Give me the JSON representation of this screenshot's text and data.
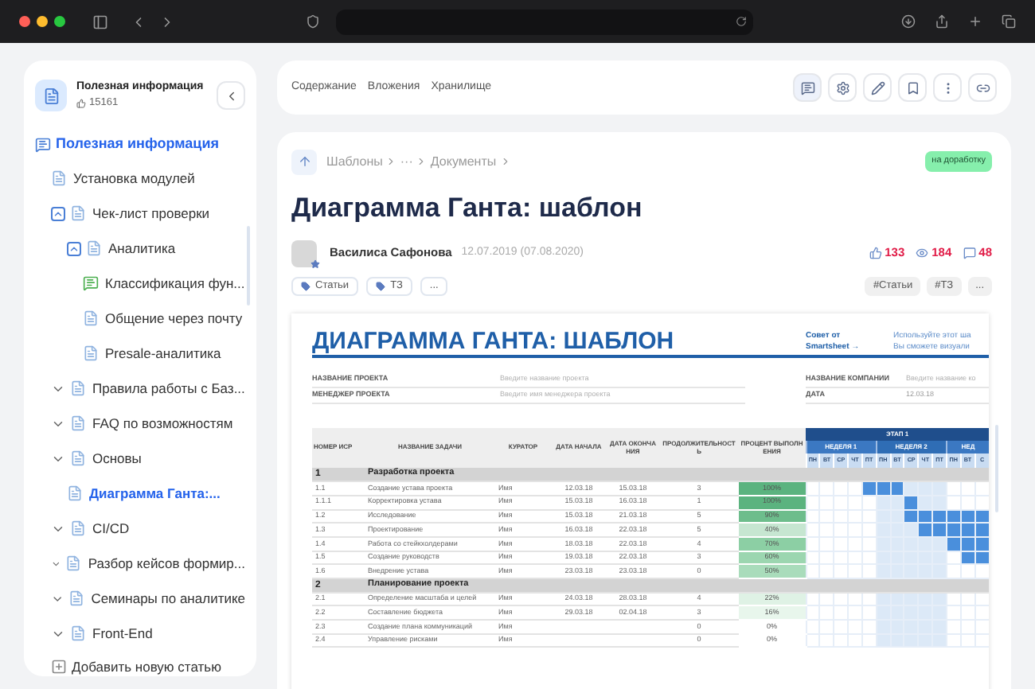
{
  "sidebar": {
    "header": {
      "title": "Полезная информация",
      "likes": "15161"
    },
    "root": {
      "label": "Полезная информация",
      "selected": false,
      "children": [
        {
          "label": "Установка модулей",
          "kind": "page",
          "selected": false
        },
        {
          "label": "Чек-лист проверки",
          "kind": "page",
          "selected": false,
          "expanded": true,
          "children": [
            {
              "label": "Аналитика",
              "kind": "page",
              "selected": false,
              "expanded": true,
              "children": [
                {
                  "label": "Классификация фун...",
                  "kind": "chat",
                  "selected": false
                },
                {
                  "label": "Общение через почту",
                  "kind": "page",
                  "selected": false
                },
                {
                  "label": "Presale-аналитика",
                  "kind": "page",
                  "selected": false
                }
              ]
            }
          ]
        },
        {
          "label": "Правила работы с Баз...",
          "kind": "page",
          "selected": false,
          "expanded": false
        },
        {
          "label": "FAQ по возможностям",
          "kind": "page",
          "selected": false,
          "expanded": false
        },
        {
          "label": "Основы",
          "kind": "page",
          "selected": false,
          "expanded": false,
          "children": [
            {
              "label": "Диаграмма Ганта:...",
              "kind": "page",
              "selected": true
            }
          ]
        },
        {
          "label": "CI/CD",
          "kind": "page",
          "selected": false,
          "expanded": false
        },
        {
          "label": "Разбор кейсов формир...",
          "kind": "page",
          "selected": false,
          "expanded": false
        },
        {
          "label": "Семинары по аналитике",
          "kind": "page",
          "selected": false,
          "expanded": false
        },
        {
          "label": "Front-End",
          "kind": "page",
          "selected": false,
          "expanded": false
        }
      ]
    },
    "add_button": "Добавить новую статью"
  },
  "toolbar": {
    "links": [
      "Содержание",
      "Вложения",
      "Хранилище"
    ]
  },
  "article": {
    "breadcrumbs": [
      "Шаблоны",
      "···",
      "Документы"
    ],
    "status": "на доработку",
    "title": "Диаграмма Ганта: шаблон",
    "author": "Василиса Сафонова",
    "date": "12.07.2019 (07.08.2020)",
    "stats": {
      "likes": "133",
      "views": "184",
      "comments": "48"
    },
    "tags": [
      "Статьи",
      "ТЗ",
      "..."
    ],
    "hashtags": [
      "#Статьи",
      "#ТЗ",
      "..."
    ]
  },
  "document": {
    "title": "ДИАГРАММА ГАНТА: ШАБЛОН",
    "tip_title": [
      "Совет от",
      "Smartsheet →"
    ],
    "tip_text": [
      "Используйте этот ша",
      "Вы сможете визуали"
    ],
    "fields_left": [
      {
        "label": "НАЗВАНИЕ ПРОЕКТА",
        "placeholder": "Введите название проекта"
      },
      {
        "label": "МЕНЕДЖЕР ПРОЕКТА",
        "placeholder": "Введите имя менеджера проекта"
      }
    ],
    "fields_right": [
      {
        "label": "НАЗВАНИЕ КОМПАНИИ",
        "placeholder": "Введите название ко"
      },
      {
        "label": "ДАТА",
        "value": "12.03.18"
      }
    ],
    "gantt": {
      "columns": [
        "НОМЕР ИСР",
        "НАЗВАНИЕ ЗАДАЧИ",
        "КУРАТОР",
        "ДАТА НАЧАЛА",
        "ДАТА ОКОНЧАНИЯ",
        "ПРОДОЛЖИТЕЛЬНОСТЬ",
        "ПРОЦЕНТ ВЫПОЛНЕНИЯ"
      ],
      "stage": "ЭТАП 1",
      "weeks": [
        {
          "label": "НЕДЕЛЯ 1",
          "current": false
        },
        {
          "label": "НЕДЕЛЯ 2",
          "current": true
        },
        {
          "label": "НЕД",
          "current": false
        }
      ],
      "days": [
        "ПН",
        "ВТ",
        "СР",
        "ЧТ",
        "ПТ",
        "ПН",
        "ВТ",
        "СР",
        "ЧТ",
        "ПТ",
        "ПН",
        "ВТ",
        "С"
      ],
      "rows": [
        {
          "kind": "section",
          "wbs": "1",
          "task": "Разработка проекта"
        },
        {
          "kind": "task",
          "wbs": "1.1",
          "task": "Создание устава проекта",
          "curator": "Имя",
          "start": "12.03.18",
          "end": "15.03.18",
          "duration": "3",
          "percent": "100%",
          "color": "#5bb37f",
          "days": [
            false,
            false,
            false,
            false,
            true,
            true,
            true,
            false,
            false,
            false,
            false,
            false,
            false
          ]
        },
        {
          "kind": "task",
          "wbs": "1.1.1",
          "task": "Корректировка устава",
          "curator": "Имя",
          "start": "15.03.18",
          "end": "16.03.18",
          "duration": "1",
          "percent": "100%",
          "color": "#5bb37f",
          "days": [
            false,
            false,
            false,
            false,
            false,
            false,
            false,
            true,
            false,
            false,
            false,
            false,
            false
          ]
        },
        {
          "kind": "task",
          "wbs": "1.2",
          "task": "Исследование",
          "curator": "Имя",
          "start": "15.03.18",
          "end": "21.03.18",
          "duration": "5",
          "percent": "90%",
          "color": "#6dbd8c",
          "days": [
            false,
            false,
            false,
            false,
            false,
            false,
            false,
            true,
            true,
            true,
            true,
            true,
            true
          ]
        },
        {
          "kind": "task",
          "wbs": "1.3",
          "task": "Проектирование",
          "curator": "Имя",
          "start": "16.03.18",
          "end": "22.03.18",
          "duration": "5",
          "percent": "40%",
          "color": "#c6e6d1",
          "days": [
            false,
            false,
            false,
            false,
            false,
            false,
            false,
            false,
            true,
            true,
            true,
            true,
            true
          ]
        },
        {
          "kind": "task",
          "wbs": "1.4",
          "task": "Работа со стейкхолдерами",
          "curator": "Имя",
          "start": "18.03.18",
          "end": "22.03.18",
          "duration": "4",
          "percent": "70%",
          "color": "#8ccfa4",
          "days": [
            false,
            false,
            false,
            false,
            false,
            false,
            false,
            false,
            false,
            false,
            true,
            true,
            true
          ]
        },
        {
          "kind": "task",
          "wbs": "1.5",
          "task": "Создание руководств",
          "curator": "Имя",
          "start": "19.03.18",
          "end": "22.03.18",
          "duration": "3",
          "percent": "60%",
          "color": "#9cd6b0",
          "days": [
            false,
            false,
            false,
            false,
            false,
            false,
            false,
            false,
            false,
            false,
            false,
            true,
            true
          ]
        },
        {
          "kind": "task",
          "wbs": "1.6",
          "task": "Внедрение устава",
          "curator": "Имя",
          "start": "23.03.18",
          "end": "23.03.18",
          "duration": "0",
          "percent": "50%",
          "color": "#a9dcbb",
          "days": [
            false,
            false,
            false,
            false,
            false,
            false,
            false,
            false,
            false,
            false,
            false,
            false,
            false
          ]
        },
        {
          "kind": "section",
          "wbs": "2",
          "task": "Планирование проекта"
        },
        {
          "kind": "task",
          "wbs": "2.1",
          "task": "Определение масштаба и целей",
          "curator": "Имя",
          "start": "24.03.18",
          "end": "28.03.18",
          "duration": "4",
          "percent": "22%",
          "color": "#dff2e5",
          "days": [
            false,
            false,
            false,
            false,
            false,
            false,
            false,
            false,
            false,
            false,
            false,
            false,
            false
          ]
        },
        {
          "kind": "task",
          "wbs": "2.2",
          "task": "Составление бюджета",
          "curator": "Имя",
          "start": "29.03.18",
          "end": "02.04.18",
          "duration": "3",
          "percent": "16%",
          "color": "#e8f6ec",
          "days": [
            false,
            false,
            false,
            false,
            false,
            false,
            false,
            false,
            false,
            false,
            false,
            false,
            false
          ]
        },
        {
          "kind": "task",
          "wbs": "2.3",
          "task": "Создание плана коммуникаций",
          "curator": "Имя",
          "duration": "0",
          "percent": "0%",
          "color": "#ffffff",
          "days": [
            false,
            false,
            false,
            false,
            false,
            false,
            false,
            false,
            false,
            false,
            false,
            false,
            false
          ]
        },
        {
          "kind": "task",
          "wbs": "2.4",
          "task": "Управление рисками",
          "curator": "Имя",
          "duration": "0",
          "percent": "0%",
          "color": "#ffffff",
          "days": [
            false,
            false,
            false,
            false,
            false,
            false,
            false,
            false,
            false,
            false,
            false,
            false,
            false
          ]
        }
      ]
    }
  }
}
